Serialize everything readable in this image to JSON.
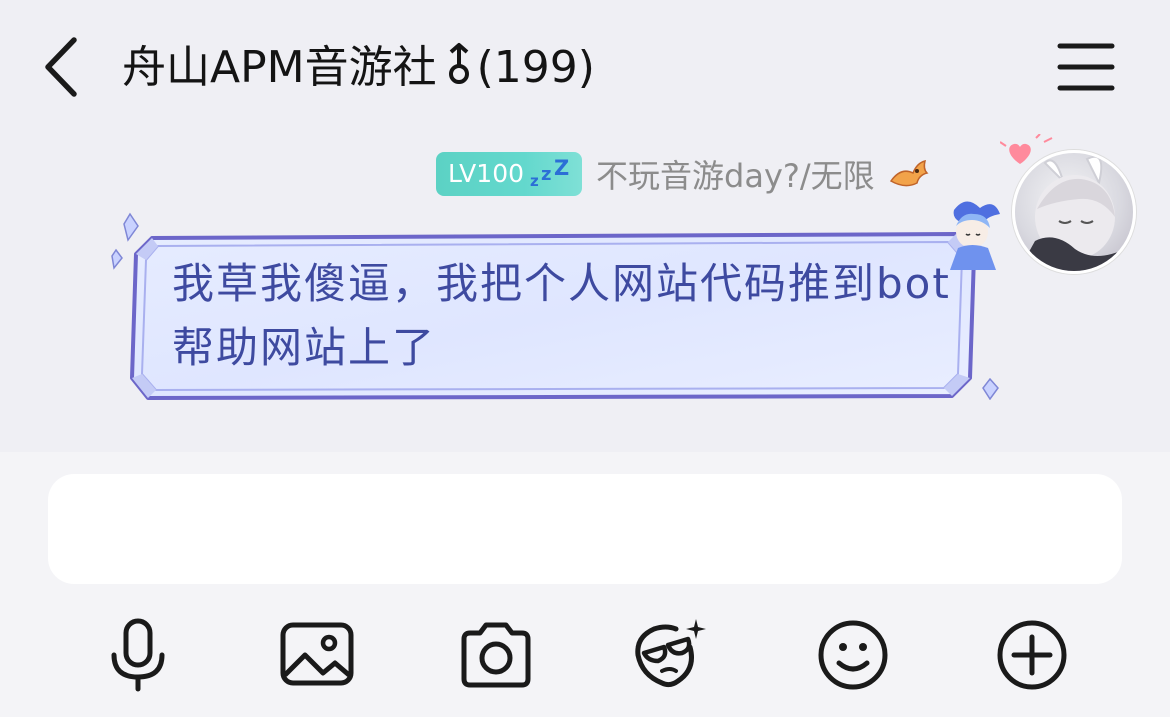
{
  "header": {
    "title": "舟山APM音游社",
    "member_count": "(199)",
    "back_icon": "chevron-left-icon",
    "menu_icon": "hamburger-menu-icon"
  },
  "message": {
    "level_badge": "LV100",
    "sender_name": "不玩音游day?/无限",
    "text": "我草我傻逼，我把个人网站代码推到bot帮助网站上了"
  },
  "input": {
    "value": "",
    "placeholder": ""
  },
  "toolbar": {
    "icons": [
      "microphone-icon",
      "image-icon",
      "camera-icon",
      "sticker-icon",
      "emoji-icon",
      "plus-icon"
    ]
  },
  "colors": {
    "background": "#efeff4",
    "bubble_text": "#3e4aa0",
    "level_badge": "#5cd2c4",
    "bubble_fill": "#dfe6ff"
  }
}
